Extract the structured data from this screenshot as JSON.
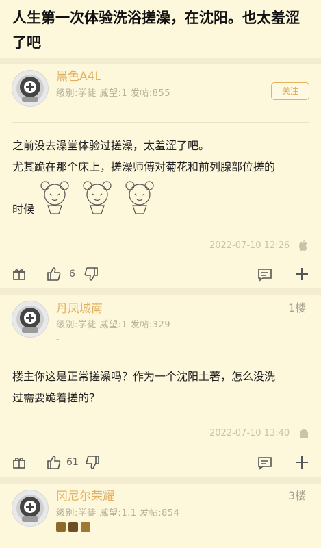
{
  "post": {
    "title": "人生第一次体验洗浴搓澡，在沈阳。也太羞涩了吧"
  },
  "floors": [
    {
      "username": "黑色A4L",
      "meta": "级别:学徒  威望:1  发帖:855",
      "sub": "-",
      "follow_label": "关注",
      "content": [
        "之前没去澡堂体验过搓澡，太羞涩了吧。",
        "尤其跪在那个床上，搓澡师傅对菊花和前列腺部位搓的",
        "时候"
      ],
      "timestamp": "2022-07-10 12:26",
      "like_count": "6"
    },
    {
      "username": "丹凤城南",
      "floor": "1楼",
      "meta": "级别:学徒  威望:1  发帖:329",
      "sub": "-",
      "content": [
        "楼主你这是正常搓澡吗？作为一个沈阳土著，怎么没洗",
        "过需要跪着搓的？"
      ],
      "timestamp": "2022-07-10 13:40",
      "like_count": "61"
    },
    {
      "username": "冈尼尔荣耀",
      "floor": "3楼",
      "meta": "级别:学徒  威望:1.1  发帖:854"
    }
  ],
  "icons": {
    "gift": "gift-icon",
    "like": "thumb-up-icon",
    "dislike": "thumb-down-icon",
    "comment": "comment-icon",
    "more": "plus-icon",
    "apple": "apple-icon",
    "android": "android-icon",
    "avatar": "diving-helmet-icon"
  },
  "colors": {
    "background": "#fdf7dc",
    "username": "#e2b061",
    "accent": "#e6b45e"
  }
}
